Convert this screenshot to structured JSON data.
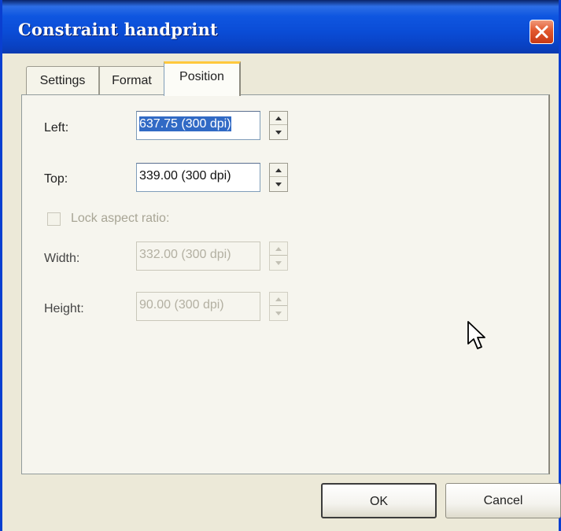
{
  "window": {
    "title": "Constraint handprint"
  },
  "tabs": [
    {
      "label": "Settings",
      "active": false
    },
    {
      "label": "Format",
      "active": false
    },
    {
      "label": "Position",
      "active": true
    }
  ],
  "fields": {
    "left": {
      "label": "Left:",
      "value": "637.75 (300 dpi)",
      "enabled": true,
      "selected": true
    },
    "top": {
      "label": "Top:",
      "value": "339.00 (300 dpi)",
      "enabled": true,
      "selected": false
    },
    "width": {
      "label": "Width:",
      "value": "332.00 (300 dpi)",
      "enabled": false,
      "selected": false
    },
    "height": {
      "label": "Height:",
      "value": "90.00 (300 dpi)",
      "enabled": false,
      "selected": false
    }
  },
  "lock_aspect": {
    "label": "Lock aspect ratio:",
    "checked": false,
    "enabled": false
  },
  "buttons": {
    "ok": "OK",
    "cancel": "Cancel"
  },
  "icons": {
    "close": "close-icon",
    "spin_up": "spin-up-arrow-icon",
    "spin_down": "spin-down-arrow-icon",
    "cursor": "mouse-cursor-icon"
  },
  "colors": {
    "title_bar": "#0a4cd6",
    "close_button": "#e2582e",
    "selection": "#316ac5",
    "active_tab_highlight": "#ffc83c",
    "dialog_background": "#ece9d8"
  }
}
